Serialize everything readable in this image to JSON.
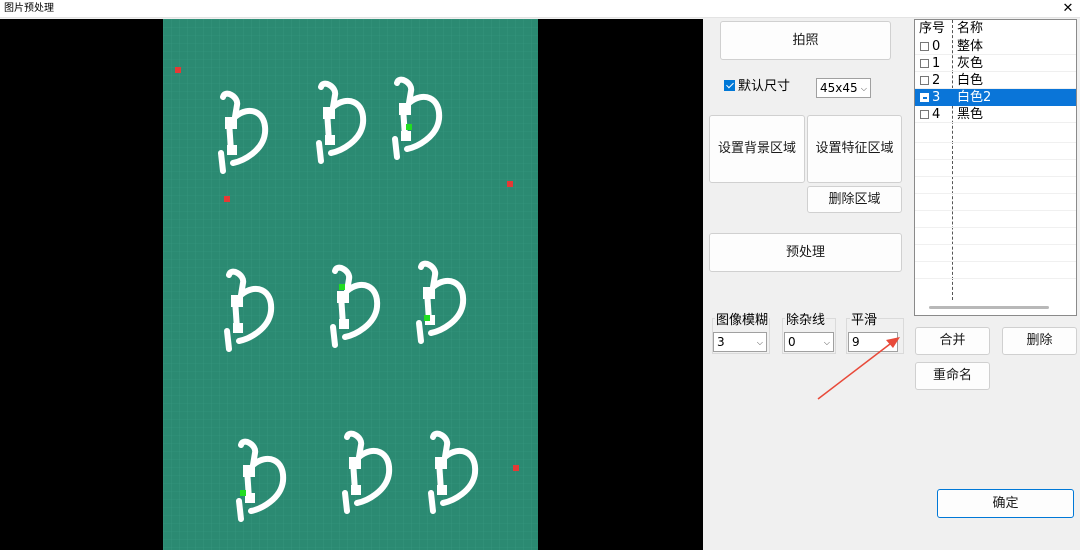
{
  "window": {
    "title": "图片预处理",
    "close_glyph": "✕"
  },
  "toolbar": {
    "capture_label": "拍照",
    "default_size_label": "默认尺寸",
    "default_size_checked": true,
    "size_value": "45x45",
    "set_bg_region_label": "设置背景区域",
    "set_feature_region_label": "设置特征区域",
    "delete_region_label": "删除区域",
    "preprocess_label": "预处理"
  },
  "params": {
    "blur_label": "图像模糊",
    "blur_value": "3",
    "remove_lines_label": "除杂线",
    "remove_lines_value": "0",
    "smooth_label": "平滑",
    "smooth_value": "9"
  },
  "list": {
    "col_index": "序号",
    "col_name": "名称",
    "rows": [
      {
        "index": "0",
        "name": "整体",
        "checked": false,
        "selected": false
      },
      {
        "index": "1",
        "name": "灰色",
        "checked": false,
        "selected": false
      },
      {
        "index": "2",
        "name": "白色",
        "checked": false,
        "selected": false
      },
      {
        "index": "3",
        "name": "白色2",
        "checked": true,
        "selected": true
      },
      {
        "index": "4",
        "name": "黑色",
        "checked": false,
        "selected": false
      }
    ]
  },
  "actions": {
    "merge_label": "合并",
    "delete_label": "删除",
    "rename_label": "重命名",
    "confirm_label": "确定"
  },
  "colors": {
    "board": "#2b8a72",
    "selection": "#0a75d8",
    "marker_red": "#e53935",
    "marker_green": "#22dd22",
    "annotation_arrow": "#e84a3a"
  },
  "icons": {
    "close": "close-icon",
    "dropdown": "chevron-down-icon",
    "checkbox": "checkbox-icon"
  }
}
